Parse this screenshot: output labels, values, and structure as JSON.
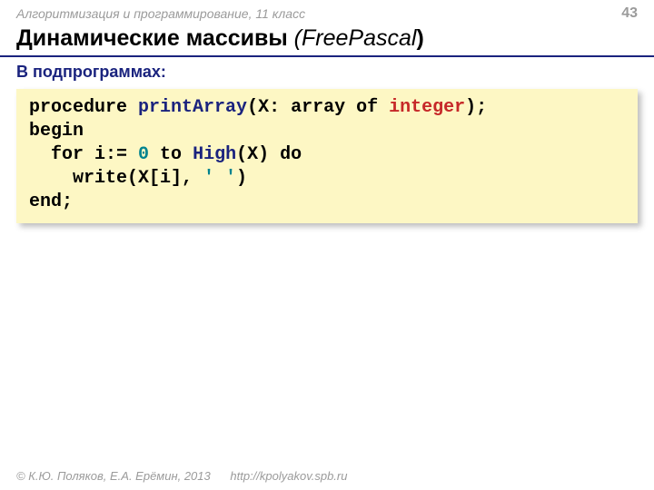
{
  "header": {
    "course": "Алгоритмизация и программирование, 11 класс",
    "page_number": "43"
  },
  "title": {
    "main": "Динамические массивы",
    "paren_open": " (",
    "lang": "FreePascal",
    "paren_close": ")"
  },
  "subtitle": "В подпрограммах:",
  "code": {
    "l1a": "procedure ",
    "l1b": "printArray",
    "l1c": "(X: array of ",
    "l1d": "integer",
    "l1e": ");",
    "l2": "begin",
    "l3a": "  for i:= ",
    "l3b": "0",
    "l3c": " to ",
    "l3d": "High",
    "l3e": "(X) do",
    "l4a": "    write(X[i], ",
    "l4b": "' '",
    "l4c": ")",
    "l5": "end;"
  },
  "footer": {
    "copyright": "© К.Ю. Поляков, Е.А. Ерёмин, 2013",
    "url": "http://kpolyakov.spb.ru"
  }
}
